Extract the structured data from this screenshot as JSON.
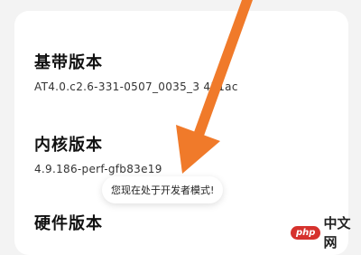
{
  "rows": {
    "baseband": {
      "label": "基带版本",
      "value": "AT4.0.c2.6-331-0507_0035_3 431ac"
    },
    "kernel": {
      "label": "内核版本",
      "value": "4.9.186-perf-gfb83e19"
    },
    "hardware": {
      "label": "硬件版本"
    }
  },
  "toast": {
    "text": "您现在处于开发者模式!"
  },
  "watermark": {
    "badge": "php",
    "text": "中文网"
  },
  "colors": {
    "arrow": "#f07a2a",
    "card": "#ffffff",
    "background": "#f3f3f3",
    "watermark_badge": "#d6322d"
  },
  "icons": {
    "annotation_arrow": "arrow-annotation-icon"
  }
}
